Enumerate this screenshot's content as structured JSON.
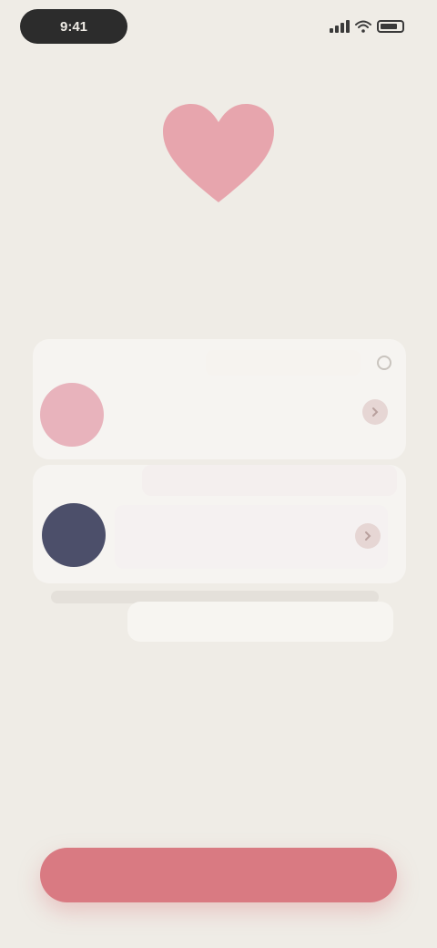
{
  "status_bar": {
    "time": "9:41",
    "icons": [
      "signal-icon",
      "wifi-icon",
      "battery-icon"
    ]
  },
  "hero": {
    "icon": "heart-icon",
    "title": "",
    "subtitle": ""
  },
  "profiles": [
    {
      "label": "",
      "initials": "",
      "name": "",
      "detail": "",
      "avatar_color": "#e8b3bc",
      "icon": "chevron-right-icon"
    },
    {
      "label": "",
      "initials": "",
      "name": "",
      "detail": "",
      "avatar_color": "#4c4f6a",
      "icon": "chevron-right-icon"
    }
  ],
  "note": {
    "label": "",
    "placeholder": ""
  },
  "cta": {
    "label": ""
  },
  "colors": {
    "background": "#efece6",
    "accent": "#d97a82",
    "heart": "#e7a5ad"
  }
}
